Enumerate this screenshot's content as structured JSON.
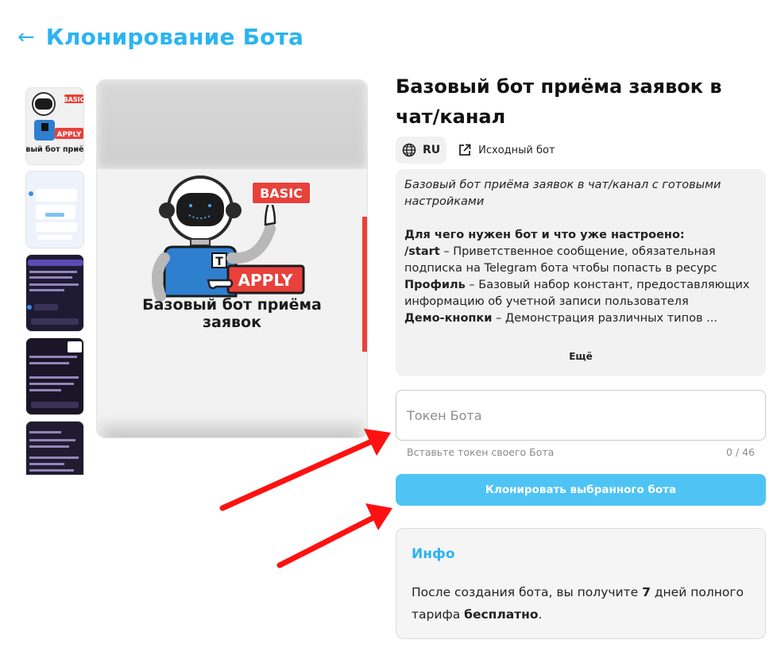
{
  "header": {
    "back_icon": "arrow-left-icon",
    "title": "Клонирование Бота"
  },
  "preview": {
    "badge_basic": "BASIC",
    "badge_apply": "APPLY",
    "bot_letter": "T",
    "caption_line1": "Базовый бот приёма",
    "caption_line2": "заявок"
  },
  "thumbnails": {
    "t1_caption": "зовый бот приёма",
    "t1_badge_basic": "BASIC",
    "t1_badge_apply": "APPLY"
  },
  "product": {
    "title_line1": "Базовый бот приёма заявок в",
    "title_line2": "чат/канал",
    "language": "RU",
    "language_icon": "globe-icon",
    "source_label": "Исходный бот",
    "source_icon": "external-link-icon"
  },
  "description": {
    "intro": "Базовый бот приёма заявок в чат/канал с готовыми настройками",
    "heading": "Для чего нужен бот и что уже настроено:",
    "items": [
      {
        "key": "/start",
        "text": " – Приветственное сообщение, обязательная подписка на Telegram бота чтобы попасть в ресурс"
      },
      {
        "key": "Профиль",
        "text": " – Базовый набор констант, предоставляющих информацию об учетной записи пользователя"
      },
      {
        "key": "Демо-кнопки",
        "text": " – Демонстрация различных типов ..."
      }
    ],
    "more_label": "Ещё"
  },
  "token": {
    "placeholder": "Токен Бота",
    "value": "",
    "helper": "Вставьте токен своего Бота",
    "counter": "0 / 46"
  },
  "clone_button": "Клонировать выбранного бота",
  "info": {
    "title": "Инфо",
    "text_part1": "После создания бота, вы получите ",
    "text_days": "7",
    "text_part2": " дней полного тарифа ",
    "text_free": "бесплатно",
    "text_end": "."
  },
  "colors": {
    "accent": "#2bb4f0",
    "button": "#4fc4f4",
    "badge_red": "#e8413b",
    "bot_blue": "#2f7fcf",
    "annotation_red": "#ff1111"
  }
}
